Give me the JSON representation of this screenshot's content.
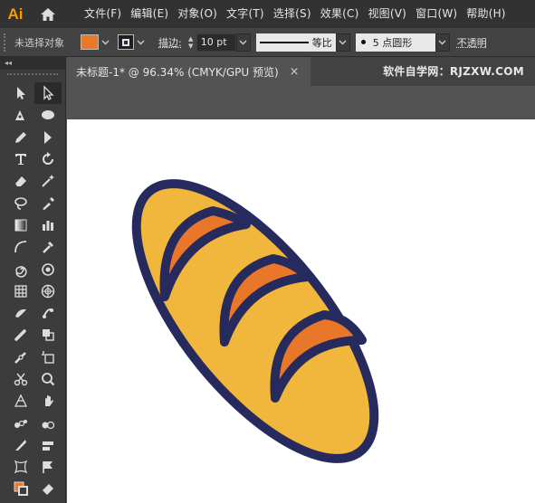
{
  "app": {
    "logo": "Ai"
  },
  "menu": [
    "文件(F)",
    "编辑(E)",
    "对象(O)",
    "文字(T)",
    "选择(S)",
    "效果(C)",
    "视图(V)",
    "窗口(W)",
    "帮助(H)"
  ],
  "control": {
    "selection_status": "未选择对象",
    "fill_color": "#e8782a",
    "stroke_label": "描边",
    "stroke_value": "10 pt",
    "profile_label": "等比",
    "brush_label": "5 点圆形",
    "opacity_label": "不透明"
  },
  "toolbar": {
    "collapse_label": "◂◂"
  },
  "document": {
    "tab_title": "未标题-1* @ 96.34% (CMYK/GPU 预览)",
    "close_glyph": "×",
    "watermark": "软件自学网：RJZXW.COM"
  },
  "artwork": {
    "bread_fill": "#f1b63c",
    "outline_color": "#262a5c",
    "slash_fill": "#e8772a"
  }
}
